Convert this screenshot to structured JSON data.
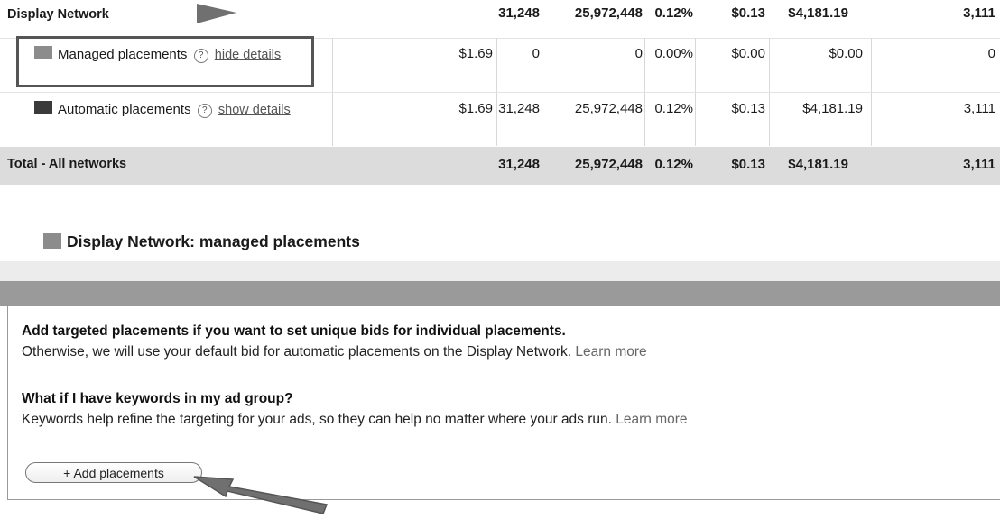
{
  "table": {
    "display_row": {
      "label": "Display Network",
      "clicks": "31,248",
      "impressions": "25,972,448",
      "ctr": "0.12%",
      "avg_cpc": "$0.13",
      "cost": "$4,181.19",
      "last": "3,111"
    },
    "managed_row": {
      "label": "Managed placements",
      "help": "?",
      "link": "hide details",
      "max_cpc": "$1.69",
      "clicks": "0",
      "impressions": "0",
      "ctr": "0.00%",
      "avg_cpc": "$0.00",
      "cost": "$0.00",
      "last": "0",
      "swatch_color": "#8c8c8c"
    },
    "automatic_row": {
      "label": "Automatic placements",
      "help": "?",
      "link": "show details",
      "max_cpc": "$1.69",
      "clicks": "31,248",
      "impressions": "25,972,448",
      "ctr": "0.12%",
      "avg_cpc": "$0.13",
      "cost": "$4,181.19",
      "last": "3,111",
      "swatch_color": "#3a3a3a"
    },
    "total_row": {
      "label": "Total - All networks",
      "clicks": "31,248",
      "impressions": "25,972,448",
      "ctr": "0.12%",
      "avg_cpc": "$0.13",
      "cost": "$4,181.19",
      "last": "3,111"
    }
  },
  "section": {
    "title": "Display Network: managed placements",
    "swatch_color": "#8c8c8c"
  },
  "info": {
    "heading1": "Add targeted placements if you want to set unique bids for individual placements.",
    "text1": "Otherwise, we will use your default bid for automatic placements on the Display Network.",
    "learn_more1": "Learn more",
    "heading2": "What if I have keywords in my ad group?",
    "text2": "Keywords help refine the targeting for your ads, so they can help no matter where your ads run.",
    "learn_more2": "Learn more"
  },
  "add_button": {
    "label": "+ Add placements"
  },
  "colors": {
    "total_row_bg": "#dcdcdc",
    "header_bar": "#9a9a9a",
    "highlight_box": "#555555",
    "arrow": "#707070"
  }
}
